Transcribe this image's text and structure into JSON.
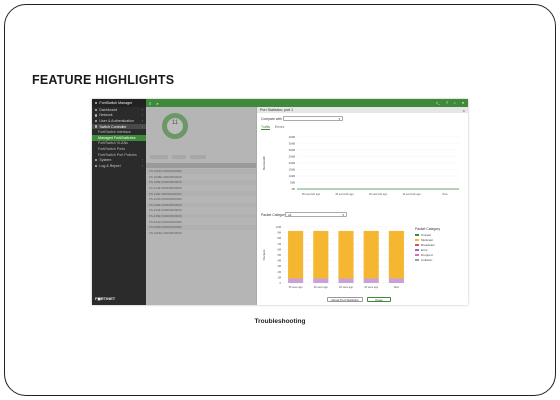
{
  "page": {
    "heading": "FEATURE HIGHLIGHTS",
    "caption": "Troubleshooting"
  },
  "sidebar": {
    "title": "FortiSwitch Manager",
    "items": [
      {
        "label": "Dashboard"
      },
      {
        "label": "Network"
      },
      {
        "label": "User & Authentication"
      },
      {
        "label": "Switch Controller",
        "active": true
      },
      {
        "label": "FortiSwitch Interface",
        "sub": true
      },
      {
        "label": "Managed FortiSwitches",
        "sub": true,
        "selected": true
      },
      {
        "label": "FortiSwitch VLANs",
        "sub": true
      },
      {
        "label": "FortiSwitch Ports",
        "sub": true
      },
      {
        "label": "FortiSwitch Port Policies",
        "sub": true
      },
      {
        "label": "System"
      },
      {
        "label": "Log & Report"
      }
    ],
    "logo": "F◼RTINET"
  },
  "main": {
    "donut_value": "11",
    "rows": [
      "FS 1024D 00000000000",
      "FS 1048E 00000000000",
      "FS 108E 000000000000",
      "FS 124E 000000000000",
      "FS 148F 000000000000",
      "FS 224D 000000000000",
      "FS 248E 000000000000",
      "FS 424E 000000000000",
      "FS 448E 000000000000",
      "FS 524D 000000000000",
      "FS 548D 000000000000",
      "FS 1024E 00000000000"
    ]
  },
  "dialog": {
    "title": "Port Statistics: port 1",
    "compare_label": "Compare with",
    "tabs": [
      "Traffic",
      "Errors"
    ],
    "packet_category_label": "Packet Category",
    "packet_category_value": "All",
    "legend_title": "Packet Category",
    "legend": [
      {
        "name": "Unicast",
        "color": "#3f8a3a"
      },
      {
        "name": "Multicast",
        "color": "#f5b731"
      },
      {
        "name": "Broadcast",
        "color": "#c75a5a"
      },
      {
        "name": "Error",
        "color": "#8a6fc4"
      },
      {
        "name": "Dropped",
        "color": "#d96fb3"
      },
      {
        "name": "Collision",
        "color": "#a0a0a0"
      }
    ],
    "reset_button": "Reset Port Statistics",
    "close_button": "Close"
  },
  "chart_data": [
    {
      "type": "line",
      "ylabel": "Bandwidth",
      "yticks": [
        "40kB",
        "35kB",
        "30kB",
        "25kB",
        "20kB",
        "15kB",
        "10kB",
        "5kB",
        "0B"
      ],
      "x": [
        "35 seconds ago",
        "30 seconds ago",
        "20 seconds ago",
        "10 seconds ago",
        "Now"
      ]
    },
    {
      "type": "bar",
      "ylabel": "Packets",
      "categories": [
        "35 secs ago",
        "30 secs ago",
        "20 secs ago",
        "10 secs ago",
        "Now"
      ],
      "series": [
        {
          "name": "Multicast",
          "values": [
            0.85,
            0.85,
            0.85,
            0.85,
            0.85
          ]
        },
        {
          "name": "Error",
          "values": [
            0.08,
            0.08,
            0.08,
            0.08,
            0.08
          ]
        }
      ],
      "yticks": [
        "10M",
        "9M",
        "8M",
        "7M",
        "6M",
        "5M",
        "4M",
        "3M",
        "2M",
        "1M",
        "0"
      ]
    }
  ]
}
